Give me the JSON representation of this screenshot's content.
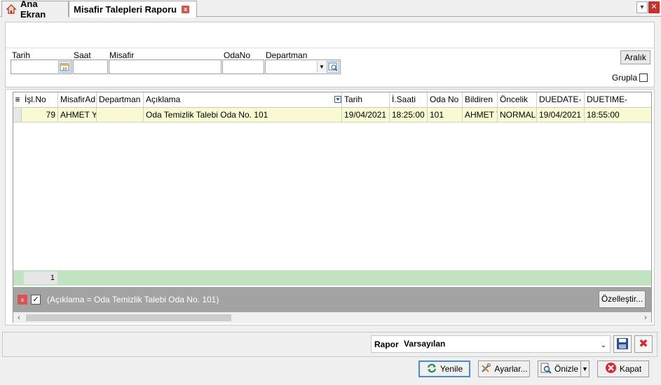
{
  "tabs": {
    "home_label": "Ana Ekran",
    "report_label": "Misafir Talepleri Raporu",
    "close_glyph": "x"
  },
  "filters": {
    "tarih_label": "Tarih",
    "saat_label": "Saat",
    "misafir_label": "Misafir",
    "odano_label": "OdaNo",
    "departman_label": "Departman",
    "aralik_label": "Aralık",
    "grupla_label": "Grupla",
    "values": {
      "tarih": "",
      "saat": "",
      "misafir": "",
      "odano": "",
      "departman": ""
    }
  },
  "grid": {
    "columns": [
      "İşl.No",
      "MisafirAd",
      "Departman",
      "Açıklama",
      "Tarih",
      "İ.Saati",
      "Oda No",
      "Bildiren",
      "Öncelik",
      "DUEDATE-",
      "DUETIME-"
    ],
    "rows": [
      [
        "79",
        "AHMET Y",
        "",
        "Oda Temizlik Talebi Oda No. 101",
        "19/04/2021",
        "18:25:00",
        "101",
        "AHMET Y",
        "NORMAL",
        "19/04/2021",
        "18:55:00"
      ]
    ],
    "footer_count": "1",
    "active_filter_text": "(Açıklama = Oda Temizlik Talebi Oda No. 101)",
    "customize_label": "Özelleştir..."
  },
  "report": {
    "label": "Rapor",
    "selected": "Varsayılan"
  },
  "buttons": {
    "yenile": "Yenile",
    "ayarlar": "Ayarlar...",
    "onizle": "Önizle",
    "kapat": "Kapat"
  },
  "colors": {
    "row_highlight": "#fafad2",
    "footer_green": "#c2e3c2",
    "filter_bar_gray": "#a3a3a3",
    "close_red": "#d9534f"
  }
}
